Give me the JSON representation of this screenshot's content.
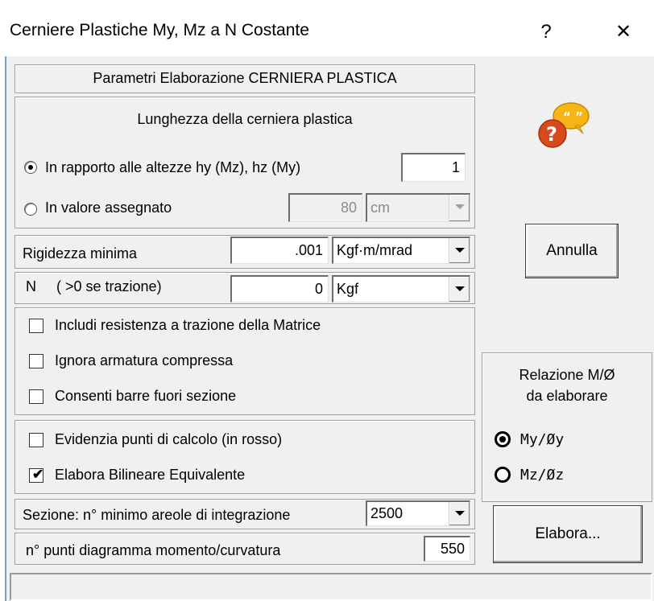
{
  "window": {
    "title": "Cerniere Plastiche My, Mz a N Costante",
    "help_glyph": "?",
    "close_glyph": "✕"
  },
  "params": {
    "header": "Parametri Elaborazione CERNIERA PLASTICA",
    "hinge_length_title": "Lunghezza della cerniera plastica",
    "option_ratio_label": "In rapporto alle altezze hy (Mz),  hz (My)",
    "option_ratio_value": "1",
    "option_assigned_label": "In valore assegnato",
    "option_assigned_value": "80",
    "option_assigned_unit": "cm",
    "selected_option": "ratio"
  },
  "stiffness": {
    "label": "Rigidezza minima",
    "value": ".001",
    "unit": "Kgf·m/mrad"
  },
  "axial": {
    "label": "N     ( >0 se trazione)",
    "value": "0",
    "unit": "Kgf"
  },
  "checks": [
    {
      "label": "Includi resistenza a trazione della Matrice",
      "checked": false
    },
    {
      "label": "Ignora armatura compressa",
      "checked": false
    },
    {
      "label": "Consenti barre fuori sezione",
      "checked": false
    },
    {
      "label": "Evidenzia punti di calcolo  (in rosso)",
      "checked": false
    },
    {
      "label": "Elabora Bilineare Equivalente",
      "checked": true
    }
  ],
  "section": {
    "label": "Sezione: n° minimo areole di integrazione",
    "value": "2500"
  },
  "diagram": {
    "label": "n° punti diagramma momento/curvatura",
    "value": "550"
  },
  "right": {
    "cancel_label": "Annulla",
    "relation_title_line1": "Relazione M/Ø",
    "relation_title_line2": "da elaborare",
    "relation_options": [
      {
        "label": "My/Øy",
        "selected": true
      },
      {
        "label": "Mz/Øz",
        "selected": false
      }
    ],
    "run_label": "Elabora..."
  },
  "status_text": "",
  "icons": {
    "help": "help-speech-bubble-icon",
    "check_glyph": "✔"
  },
  "colors": {
    "window_bg": "#f0f0f0",
    "border_accent": "#7a9cc6",
    "bubble_yellow": "#f6b417",
    "help_red": "#d84a1b"
  }
}
